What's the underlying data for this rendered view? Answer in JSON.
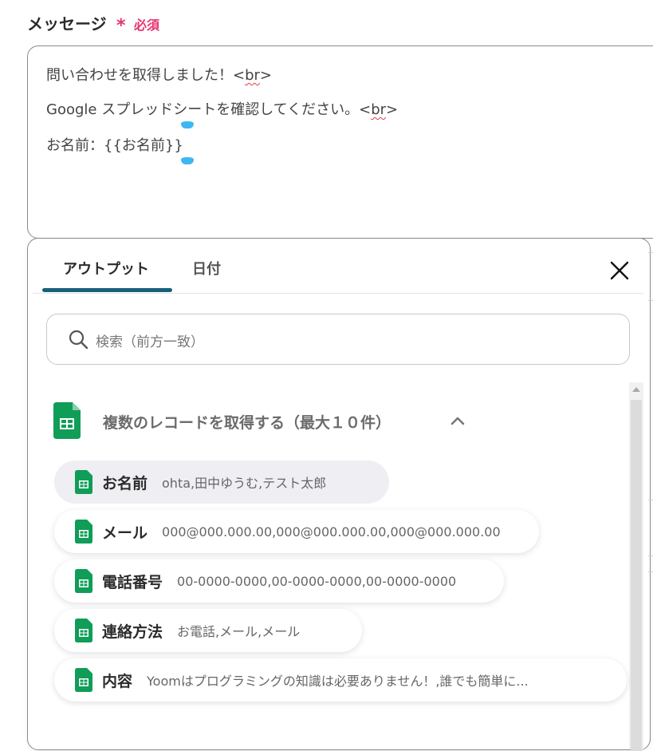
{
  "field": {
    "label": "メッセージ",
    "required_mark": "*",
    "required_text": "必須"
  },
  "message": {
    "line1_text": "問い合わせを取得しました！<",
    "line1_tag": "br",
    "line1_end": ">",
    "line2_text": "Google スプレッドシートを確認してください。<",
    "line2_tag": "br",
    "line2_end": ">",
    "line3_text": "お名前：{{お名前}}"
  },
  "popover": {
    "tabs": [
      {
        "label": "アウトプット",
        "active": true
      },
      {
        "label": "日付",
        "active": false
      }
    ],
    "close_icon": "close-icon",
    "search": {
      "placeholder": "検索（前方一致）",
      "icon": "search-icon"
    },
    "group": {
      "title": "複数のレコードを取得する（最大１０件）",
      "icon": "google-sheets-icon",
      "expanded": true
    },
    "items": [
      {
        "name": "お名前",
        "value": "ohta,田中ゆうむ,テスト太郎"
      },
      {
        "name": "メール",
        "value": "000@000.000.00,000@000.000.00,000@000.000.00"
      },
      {
        "name": "電話番号",
        "value": "00-0000-0000,00-0000-0000,00-0000-0000"
      },
      {
        "name": "連絡方法",
        "value": "お電話,メール,メール"
      },
      {
        "name": "内容",
        "value": "Yoomはプログラミングの知識は必要ありません！,誰でも簡単に..."
      }
    ]
  },
  "colors": {
    "required": "#e5336f",
    "tab_underline": "#17607a",
    "sheets_green": "#0f9d58",
    "cursor_marker": "#3fb6f2"
  }
}
